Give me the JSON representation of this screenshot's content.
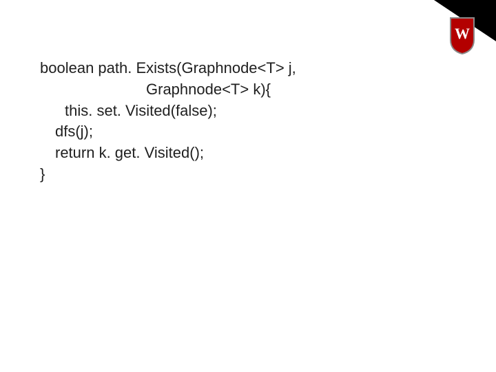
{
  "code": {
    "l1": "boolean path. Exists(Graphnode<T> j,",
    "l2": "Graphnode<T> k){",
    "l3": "this. set. Visited(false);",
    "l4": "dfs(j);",
    "l5": "return k. get. Visited();",
    "l6": "}"
  },
  "logo": {
    "letter": "W",
    "shield_fill": "#b30000",
    "shield_stroke": "#8a8a8a",
    "letter_fill": "#ffffff"
  }
}
